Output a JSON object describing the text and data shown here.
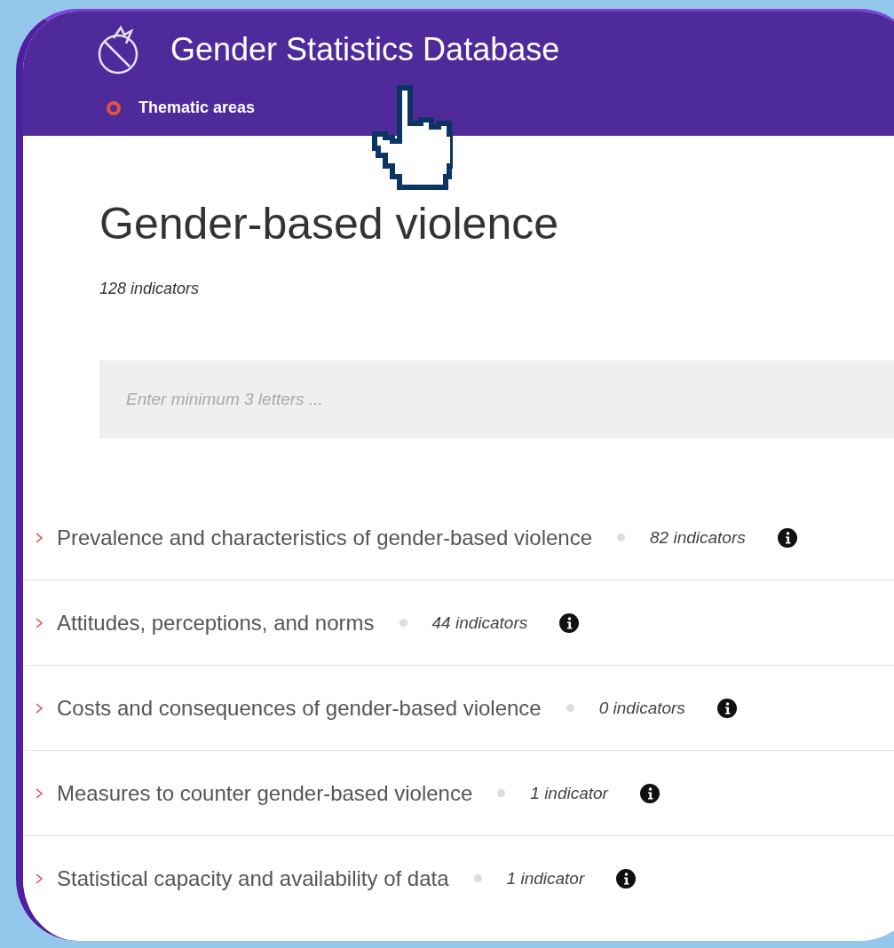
{
  "header": {
    "title": "Gender Statistics Database",
    "nav": [
      {
        "label": "Thematic areas"
      }
    ]
  },
  "page": {
    "title": "Gender-based violence",
    "count": "128 indicators"
  },
  "search": {
    "placeholder": "Enter minimum 3 letters ..."
  },
  "topics": [
    {
      "title": "Prevalence and characteristics of gender-based violence",
      "count": "82 indicators",
      "expanded": false
    },
    {
      "title": "Attitudes, perceptions, and norms",
      "count": "44 indicators",
      "expanded": false
    },
    {
      "title": "Costs and consequences of gender-based violence",
      "count": "0 indicators",
      "expanded": false
    },
    {
      "title": "Measures to counter gender-based violence",
      "count": "1 indicator",
      "expanded": false
    },
    {
      "title": "Statistical capacity and availability of data",
      "count": "1 indicator",
      "expanded": false
    }
  ]
}
